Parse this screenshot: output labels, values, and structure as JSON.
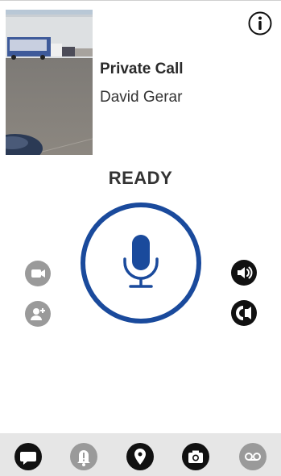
{
  "call": {
    "type_label": "Private Call",
    "contact_name": "David Gerar",
    "status": "READY"
  },
  "colors": {
    "accent_blue": "#1a4a9c",
    "icon_dark": "#111111",
    "icon_gray": "#9a9a9a",
    "bottom_bar": "#e6e6e6"
  },
  "icons": {
    "info": "info-icon",
    "ptt": "microphone-icon",
    "video": "video-camera-icon",
    "add_user": "add-user-icon",
    "speaker": "speaker-icon",
    "earpiece": "earpiece-icon",
    "nav": [
      "chat-icon",
      "alert-bell-icon",
      "location-pin-icon",
      "camera-icon",
      "voicemail-icon"
    ]
  }
}
